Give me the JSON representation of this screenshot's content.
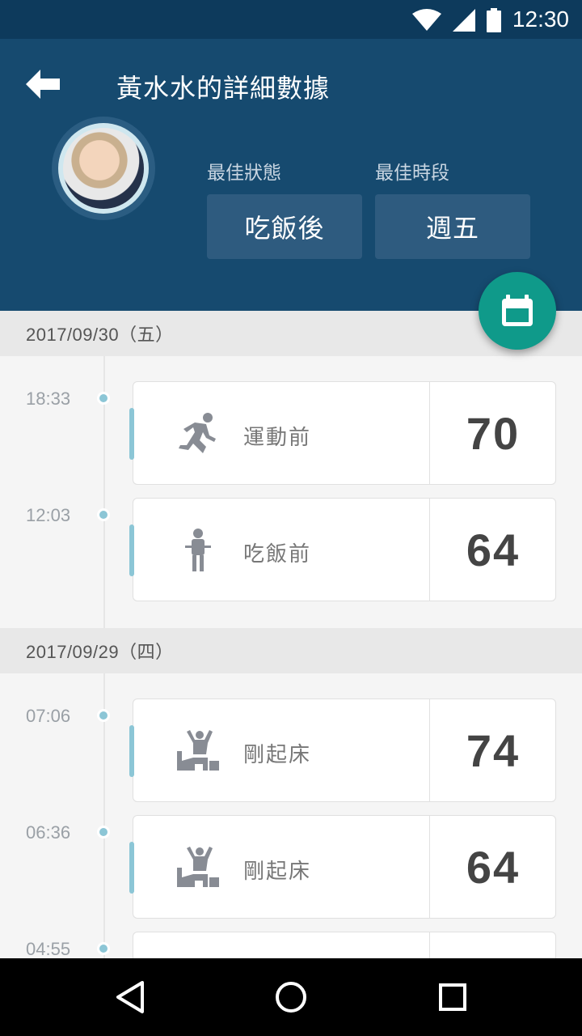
{
  "status_bar": {
    "time": "12:30",
    "icons": [
      "wifi-icon",
      "cell-signal-icon",
      "battery-icon"
    ]
  },
  "header": {
    "title": "黃水水的詳細數據",
    "back_icon": "arrow-left-icon"
  },
  "best": [
    {
      "label": "最佳狀態",
      "value": "吃飯後"
    },
    {
      "label": "最佳時段",
      "value": "週五"
    }
  ],
  "fab": {
    "icon": "calendar-icon"
  },
  "groups": [
    {
      "date": "2017/09/30（五）",
      "entries": [
        {
          "time": "18:33",
          "label": "運動前",
          "value": "70",
          "icon": "running-icon"
        },
        {
          "time": "12:03",
          "label": "吃飯前",
          "value": "64",
          "icon": "eating-person-icon"
        }
      ]
    },
    {
      "date": "2017/09/29（四）",
      "entries": [
        {
          "time": "07:06",
          "label": "剛起床",
          "value": "74",
          "icon": "waking-up-icon"
        },
        {
          "time": "06:36",
          "label": "剛起床",
          "value": "64",
          "icon": "waking-up-icon"
        },
        {
          "time": "04:55",
          "label": "",
          "value": "",
          "icon": ""
        }
      ]
    }
  ],
  "colors": {
    "header": "#164a6f",
    "status_bar": "#0d3a5c",
    "fab": "#0f9a8a",
    "accent": "#8cc6d6"
  },
  "nav": {
    "icons": [
      "back-triangle-icon",
      "home-circle-icon",
      "recents-square-icon"
    ]
  }
}
